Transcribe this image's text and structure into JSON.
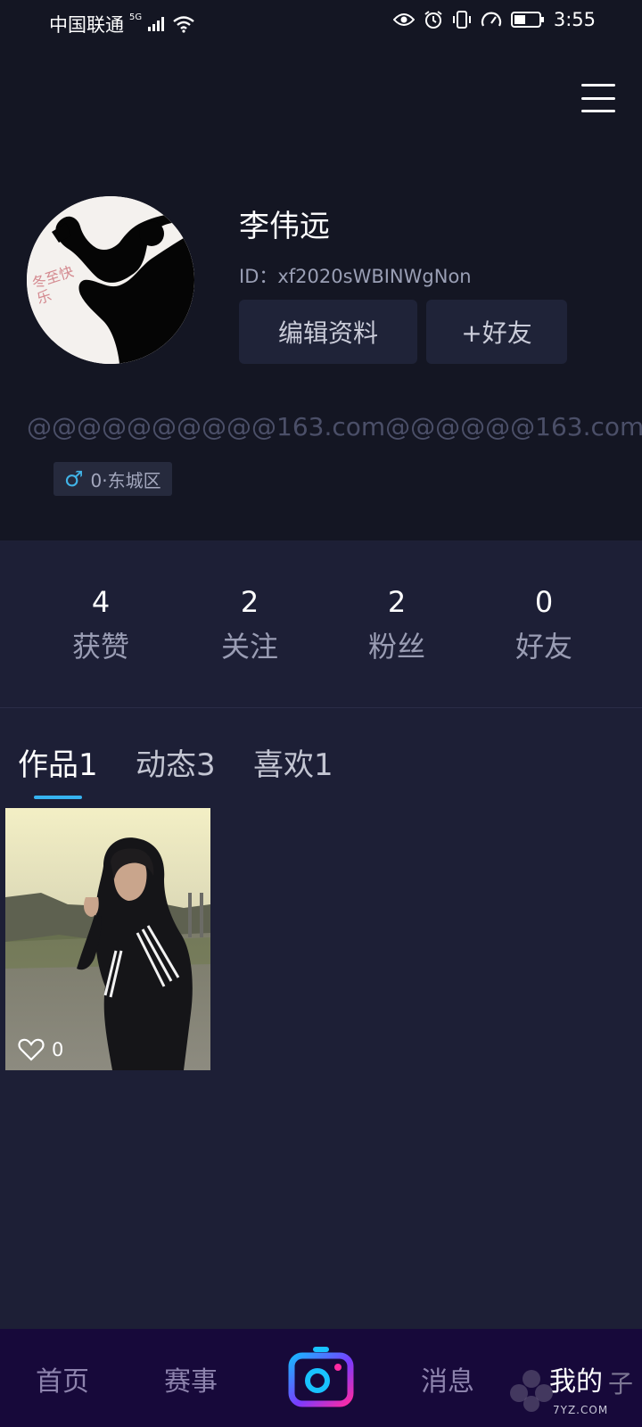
{
  "status_bar": {
    "carrier": "中国联通",
    "network": "5G",
    "time": "3:55"
  },
  "profile": {
    "name": "李伟远",
    "id_text": "ID：xf2020sWBINWgNon",
    "edit_button": "编辑资料",
    "add_friend_button": "+好友",
    "signature": "@@@@@@@@@@163.com@@@@@@163.com",
    "gender_location": "0·东城区",
    "avatar_watermark": "冬至快乐"
  },
  "stats": [
    {
      "value": "4",
      "label": "获赞"
    },
    {
      "value": "2",
      "label": "关注"
    },
    {
      "value": "2",
      "label": "粉丝"
    },
    {
      "value": "0",
      "label": "好友"
    }
  ],
  "tabs": [
    {
      "label": "作品1"
    },
    {
      "label": "动态3"
    },
    {
      "label": "喜欢1"
    }
  ],
  "works": [
    {
      "likes": "0"
    }
  ],
  "bottom_nav": {
    "home": "首页",
    "events": "赛事",
    "messages": "消息",
    "mine": "我的",
    "watermark_glyph": "子",
    "watermark_text": "7YZ.COM"
  },
  "colors": {
    "accent": "#36b3f0",
    "nav_bg": "#17093a",
    "camera_gradient": [
      "#19b6ff",
      "#ff2aa2"
    ]
  }
}
